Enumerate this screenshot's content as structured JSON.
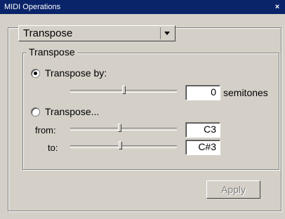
{
  "window": {
    "title": "MIDI Operations",
    "close_glyph": "×"
  },
  "operation_select": {
    "selected": "Transpose"
  },
  "group": {
    "title": "Transpose"
  },
  "transpose_by": {
    "label": "Transpose by:",
    "checked": true,
    "slider_level": 0.5,
    "value": "0",
    "unit": "semitones"
  },
  "transpose_range": {
    "label": "Transpose...",
    "checked": false,
    "from_label": "from:",
    "from_value": "C3",
    "from_slider_level": 0.45,
    "to_label": "to:",
    "to_value": "C#3",
    "to_slider_level": 0.46
  },
  "apply_button": {
    "label": "Apply",
    "enabled": false
  }
}
